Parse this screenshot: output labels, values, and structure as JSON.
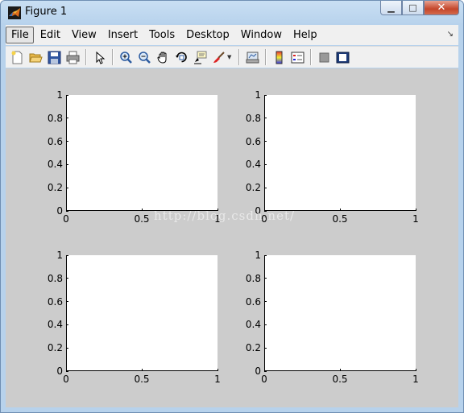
{
  "window": {
    "title": "Figure 1",
    "minimize_glyph": "▁",
    "maximize_glyph": "□",
    "close_glyph": "✕"
  },
  "menu": {
    "items": [
      "File",
      "Edit",
      "View",
      "Insert",
      "Tools",
      "Desktop",
      "Window",
      "Help"
    ],
    "overflow_glyph": "↘"
  },
  "toolbar": {
    "buttons": [
      "new-figure-icon",
      "open-file-icon",
      "save-icon",
      "print-icon",
      "edit-plot-arrow-icon",
      "zoom-in-icon",
      "zoom-out-icon",
      "pan-hand-icon",
      "rotate-3d-icon",
      "data-cursor-icon",
      "brush-icon",
      "link-plot-icon",
      "insert-colorbar-icon",
      "insert-legend-icon",
      "hide-plot-tools-icon",
      "show-plot-tools-icon"
    ],
    "dropdown_glyph": "▼"
  },
  "axes": {
    "y_ticks": [
      "0",
      "0.2",
      "0.4",
      "0.6",
      "0.8",
      "1"
    ],
    "x_ticks": [
      "0",
      "0.5",
      "1"
    ]
  },
  "watermark": "http://blog.csdn.net/",
  "chart_data": [
    {
      "type": "line",
      "series": [],
      "xlim": [
        0,
        1
      ],
      "ylim": [
        0,
        1
      ],
      "x_ticks": [
        0,
        0.5,
        1
      ],
      "y_ticks": [
        0,
        0.2,
        0.4,
        0.6,
        0.8,
        1
      ]
    },
    {
      "type": "line",
      "series": [],
      "xlim": [
        0,
        1
      ],
      "ylim": [
        0,
        1
      ],
      "x_ticks": [
        0,
        0.5,
        1
      ],
      "y_ticks": [
        0,
        0.2,
        0.4,
        0.6,
        0.8,
        1
      ]
    },
    {
      "type": "line",
      "series": [],
      "xlim": [
        0,
        1
      ],
      "ylim": [
        0,
        1
      ],
      "x_ticks": [
        0,
        0.5,
        1
      ],
      "y_ticks": [
        0,
        0.2,
        0.4,
        0.6,
        0.8,
        1
      ]
    },
    {
      "type": "line",
      "series": [],
      "xlim": [
        0,
        1
      ],
      "ylim": [
        0,
        1
      ],
      "x_ticks": [
        0,
        0.5,
        1
      ],
      "y_ticks": [
        0,
        0.2,
        0.4,
        0.6,
        0.8,
        1
      ]
    }
  ]
}
